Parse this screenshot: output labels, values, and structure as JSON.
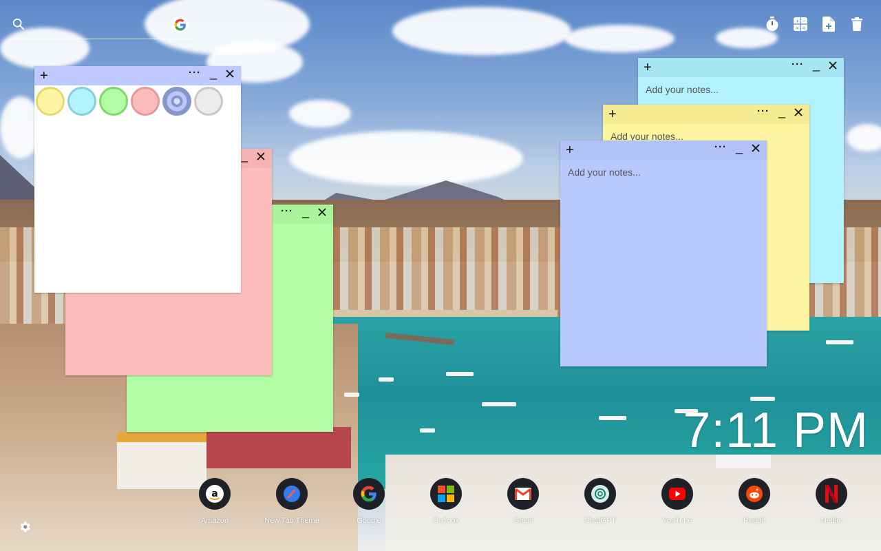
{
  "search": {
    "placeholder": ""
  },
  "top_actions": [
    {
      "name": "timer-icon"
    },
    {
      "name": "calculator-icon"
    },
    {
      "name": "add-note-icon"
    },
    {
      "name": "trash-icon"
    }
  ],
  "notes": {
    "placeholder": "Add your notes...",
    "add_symbol": "+",
    "more_symbol": "···",
    "min_symbol": "_",
    "colors": {
      "white": "#ffffff",
      "pink": "#fdbcbc",
      "green": "#b2fda4",
      "yellow": "#fdf5a2",
      "cyan": "#b2f2fd",
      "lavender": "#b9c8fd"
    }
  },
  "palette": [
    {
      "name": "yellow-swatch",
      "fill": "#fdf5a2",
      "ring": "#e5da6c"
    },
    {
      "name": "cyan-swatch",
      "fill": "#b2f2fd",
      "ring": "#86cfe0"
    },
    {
      "name": "green-swatch",
      "fill": "#b2fda4",
      "ring": "#80d870"
    },
    {
      "name": "pink-swatch",
      "fill": "#fdbcbc",
      "ring": "#e49a9a"
    },
    {
      "name": "lavender-swatch",
      "fill": "#b9c8fd",
      "ring": "#8796c8"
    },
    {
      "name": "grey-swatch",
      "fill": "#ececec",
      "ring": "#c8c8c8"
    }
  ],
  "clock": {
    "time": "7:11 PM"
  },
  "shortcuts": [
    {
      "name": "Amazon",
      "icon": "amazon-icon"
    },
    {
      "name": "New Tab Theme",
      "icon": "new-tab-theme-icon"
    },
    {
      "name": "Google",
      "icon": "google-icon"
    },
    {
      "name": "Outlook",
      "icon": "microsoft-icon"
    },
    {
      "name": "Gmail",
      "icon": "gmail-icon"
    },
    {
      "name": "ChatGPT",
      "icon": "chatgpt-icon"
    },
    {
      "name": "YouTube",
      "icon": "youtube-icon"
    },
    {
      "name": "Reddit",
      "icon": "reddit-icon"
    },
    {
      "name": "Netflix",
      "icon": "netflix-icon"
    }
  ]
}
